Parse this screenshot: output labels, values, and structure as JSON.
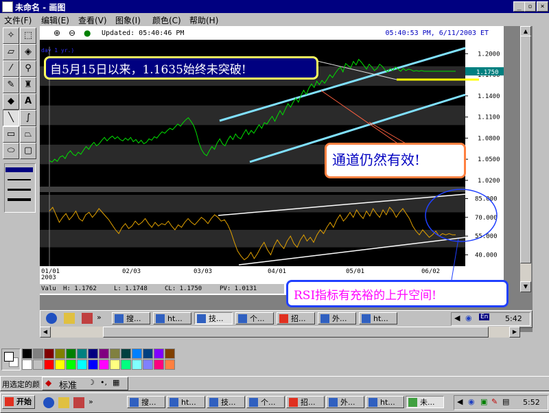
{
  "window": {
    "title": "未命名 - 画图",
    "controls": [
      "minimize",
      "restore",
      "close"
    ]
  },
  "menu": {
    "items": [
      {
        "label": "文件(F)"
      },
      {
        "label": "编辑(E)"
      },
      {
        "label": "查看(V)"
      },
      {
        "label": "图象(I)"
      },
      {
        "label": "颜色(C)"
      },
      {
        "label": "帮助(H)"
      }
    ]
  },
  "chart_header": {
    "updated": "Updated: 05:40:46 PM",
    "timestamp": "05:40:53 PM, 6/11/2003 ET",
    "series_label": "day  1 yr.)"
  },
  "annotations": {
    "top_note": "自5月15日以来，1.1635始终未突破!",
    "channel_note": "通道仍然有效!",
    "rsi_note": "RSI指标有充裕的上升空间!"
  },
  "chart_data": [
    {
      "type": "line",
      "name": "price",
      "yticks": [
        "1.2000",
        "1.1700",
        "1.1400",
        "1.1100",
        "1.0800",
        "1.0500",
        "1.0200"
      ],
      "ylim": [
        1.015,
        1.21
      ],
      "last_value_label": "1.1750",
      "x": [
        0,
        4,
        8,
        12,
        16,
        20,
        24,
        28,
        32,
        36,
        40,
        44,
        48,
        52,
        56,
        60,
        64,
        68,
        72,
        76,
        80,
        84,
        88,
        92,
        96,
        100,
        104,
        108,
        112,
        116,
        120,
        124,
        128,
        132,
        136,
        140,
        144,
        148,
        152,
        156,
        160,
        164,
        168,
        172,
        176,
        180,
        184,
        188,
        192,
        196,
        200,
        204,
        208,
        212,
        216,
        220,
        224,
        228,
        232,
        236,
        240,
        244,
        248,
        252,
        256,
        260,
        264,
        268,
        272,
        276,
        280,
        284,
        288,
        292,
        296,
        300,
        304,
        308,
        312,
        316,
        320,
        324,
        328,
        332,
        336,
        340,
        344,
        348,
        352,
        356,
        360,
        364,
        368,
        372,
        376,
        380,
        384,
        388,
        392,
        396,
        400,
        404,
        408,
        412,
        416,
        420,
        424,
        428,
        432,
        436,
        440,
        444,
        448,
        452,
        456,
        460,
        464,
        468,
        472,
        476,
        480,
        484,
        488,
        492,
        496,
        500,
        504,
        508,
        512,
        516,
        520,
        524,
        528,
        532,
        536,
        540,
        544,
        548,
        552,
        556,
        560,
        564,
        568,
        572,
        576,
        580,
        584,
        588,
        592,
        596,
        600,
        604,
        608,
        612
      ],
      "values": [
        1.048,
        1.046,
        1.05,
        1.047,
        1.053,
        1.055,
        1.051,
        1.058,
        1.062,
        1.057,
        1.055,
        1.06,
        1.057,
        1.063,
        1.068,
        1.064,
        1.07,
        1.074,
        1.069,
        1.072,
        1.077,
        1.081,
        1.076,
        1.08,
        1.083,
        1.079,
        1.082,
        1.078,
        1.076,
        1.08,
        1.077,
        1.081,
        1.075,
        1.078,
        1.073,
        1.077,
        1.072,
        1.074,
        1.079,
        1.077,
        1.082,
        1.08,
        1.085,
        1.089,
        1.087,
        1.091,
        1.094,
        1.092,
        1.096,
        1.1,
        1.097,
        1.102,
        1.106,
        1.109,
        1.104,
        1.098,
        1.088,
        1.074,
        1.064,
        1.058,
        1.055,
        1.062,
        1.068,
        1.064,
        1.073,
        1.079,
        1.072,
        1.069,
        1.077,
        1.083,
        1.078,
        1.086,
        1.081,
        1.079,
        1.086,
        1.092,
        1.085,
        1.091,
        1.087,
        1.093,
        1.099,
        1.094,
        1.102,
        1.1,
        1.106,
        1.111,
        1.104,
        1.112,
        1.119,
        1.113,
        1.121,
        1.129,
        1.124,
        1.131,
        1.137,
        1.131,
        1.141,
        1.148,
        1.142,
        1.151,
        1.157,
        1.152,
        1.161,
        1.156,
        1.162,
        1.158,
        1.164,
        1.17,
        1.166,
        1.172,
        1.177,
        1.181,
        1.174,
        1.186,
        1.183,
        1.18,
        1.189,
        1.184,
        1.192,
        1.188,
        1.183,
        1.178,
        1.185,
        1.181,
        1.176,
        1.179,
        1.185,
        1.182,
        1.177,
        1.174,
        1.179,
        1.176,
        1.181,
        1.178,
        1.175,
        1.179,
        1.176,
        1.178,
        1.177,
        1.175,
        1.176,
        1.175,
        1.176,
        1.175,
        1.175,
        1.175,
        1.175,
        1.175,
        1.175,
        1.175,
        1.175,
        1.175,
        1.175,
        1.175,
        1.175,
        1.175
      ]
    },
    {
      "type": "line",
      "name": "RSI",
      "yticks": [
        "85.000",
        "70.000",
        "55.000",
        "40.000"
      ],
      "ylim": [
        32,
        88
      ],
      "x_categories": [
        "01/01\n2003",
        "02/03",
        "03/03",
        "04/01",
        "05/01",
        "06/02"
      ],
      "values": [
        75,
        78,
        72,
        66,
        70,
        73,
        68,
        71,
        75,
        69,
        67,
        72,
        74,
        70,
        73,
        77,
        74,
        71,
        68,
        64,
        60,
        57,
        62,
        65,
        61,
        63,
        67,
        64,
        66,
        69,
        65,
        62,
        66,
        63,
        65,
        64,
        67,
        63,
        60,
        64,
        62,
        66,
        69,
        66,
        64,
        67,
        70,
        68,
        65,
        69,
        72,
        70,
        67,
        68,
        64,
        58,
        50,
        43,
        39,
        36,
        38,
        42,
        37,
        41,
        46,
        50,
        44,
        40,
        47,
        52,
        48,
        45,
        51,
        55,
        49,
        46,
        52,
        56,
        51,
        54,
        50,
        56,
        60,
        57,
        62,
        66,
        62,
        68,
        72,
        67,
        70,
        74,
        70,
        76,
        72,
        69,
        75,
        71,
        77,
        73,
        70,
        76,
        72,
        78,
        75,
        70,
        74,
        77,
        73,
        69,
        63,
        59,
        56,
        60,
        57,
        54,
        56,
        59,
        55,
        57,
        56,
        57,
        56,
        56
      ]
    }
  ],
  "value_strip": {
    "label": "Valu",
    "h": "H: 1.1762",
    "l": "L: 1.1748",
    "cl": "CL: 1.1750",
    "pv": "PV: 1.0131"
  },
  "inner_taskbar": {
    "buttons": [
      {
        "label": "搜..."
      },
      {
        "label": "ht..."
      },
      {
        "label": "技..."
      },
      {
        "label": "个..."
      },
      {
        "label": "招..."
      },
      {
        "label": "外..."
      },
      {
        "label": "ht..."
      }
    ],
    "clock": "5:42",
    "lang": "En"
  },
  "palette": {
    "colors": [
      "#000000",
      "#808080",
      "#800000",
      "#808000",
      "#008000",
      "#008080",
      "#000080",
      "#800080",
      "#808040",
      "#004040",
      "#0080ff",
      "#004080",
      "#8000ff",
      "#804000",
      "#ffffff",
      "#c0c0c0",
      "#ff0000",
      "#ffff00",
      "#00ff00",
      "#00ffff",
      "#0000ff",
      "#ff00ff",
      "#ffff80",
      "#00ff80",
      "#80ffff",
      "#8080ff",
      "#ff0080",
      "#ff8040"
    ]
  },
  "status_bar": {
    "hint": "用选定的颜",
    "ime": "标准"
  },
  "taskbar": {
    "start": "开始",
    "buttons": [
      {
        "label": "搜..."
      },
      {
        "label": "ht..."
      },
      {
        "label": "技..."
      },
      {
        "label": "个..."
      },
      {
        "label": "招..."
      },
      {
        "label": "外..."
      },
      {
        "label": "ht..."
      },
      {
        "label": "未..."
      }
    ],
    "clock": "5:52"
  }
}
